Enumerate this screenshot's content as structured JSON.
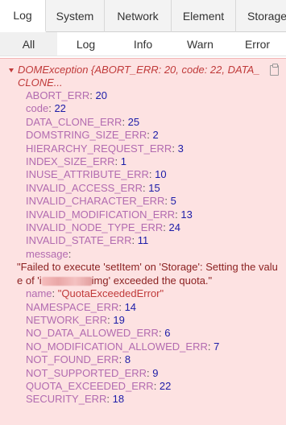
{
  "tabs": [
    "Log",
    "System",
    "Network",
    "Element",
    "Storage"
  ],
  "active_tab": 0,
  "filters": [
    "All",
    "Log",
    "Info",
    "Warn",
    "Error"
  ],
  "active_filter": 0,
  "entry": {
    "header": "DOMException {ABORT_ERR: 20, code: 22, DATA_CLONE...",
    "props_before": [
      {
        "key": "ABORT_ERR",
        "value": "20"
      },
      {
        "key": "code",
        "value": "22"
      },
      {
        "key": "DATA_CLONE_ERR",
        "value": "25"
      },
      {
        "key": "DOMSTRING_SIZE_ERR",
        "value": "2"
      },
      {
        "key": "HIERARCHY_REQUEST_ERR",
        "value": "3"
      },
      {
        "key": "INDEX_SIZE_ERR",
        "value": "1"
      },
      {
        "key": "INUSE_ATTRIBUTE_ERR",
        "value": "10"
      },
      {
        "key": "INVALID_ACCESS_ERR",
        "value": "15"
      },
      {
        "key": "INVALID_CHARACTER_ERR",
        "value": "5"
      },
      {
        "key": "INVALID_MODIFICATION_ERR",
        "value": "13"
      },
      {
        "key": "INVALID_NODE_TYPE_ERR",
        "value": "24"
      },
      {
        "key": "INVALID_STATE_ERR",
        "value": "11"
      }
    ],
    "message_key": "message",
    "message_before": "\"Failed to execute 'setItem' on 'Storage': Setting the value of 'i",
    "message_after": "img' exceeded the quota.\"",
    "name_key": "name",
    "name_value": "\"QuotaExceededError\"",
    "props_after": [
      {
        "key": "NAMESPACE_ERR",
        "value": "14"
      },
      {
        "key": "NETWORK_ERR",
        "value": "19"
      },
      {
        "key": "NO_DATA_ALLOWED_ERR",
        "value": "6"
      },
      {
        "key": "NO_MODIFICATION_ALLOWED_ERR",
        "value": "7"
      },
      {
        "key": "NOT_FOUND_ERR",
        "value": "8"
      },
      {
        "key": "NOT_SUPPORTED_ERR",
        "value": "9"
      },
      {
        "key": "QUOTA_EXCEEDED_ERR",
        "value": "22"
      },
      {
        "key": "SECURITY_ERR",
        "value": "18"
      }
    ]
  },
  "icons": {
    "expand": "caret-down-icon",
    "copy": "clipboard-icon"
  },
  "colors": {
    "entry_bg": "#fde2e2",
    "error_text": "#c03a3a",
    "key": "#b26bb0",
    "number": "#1c1ca8",
    "message": "#8a1f1f"
  }
}
